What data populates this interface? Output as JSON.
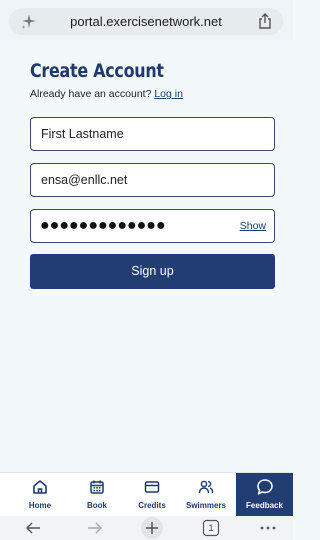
{
  "browser": {
    "url": "portal.exercisenetwork.net",
    "tab_count": "1"
  },
  "form": {
    "title": "Create Account",
    "subtitle_text": "Already have an account?",
    "login_link": "Log in",
    "name_value": "First Lastname",
    "email_value": "ensa@enllc.net",
    "password_masked": "●●●●●●●●●●●●●",
    "show_label": "Show",
    "signup_label": "Sign up"
  },
  "nav": {
    "items": [
      {
        "label": "Home",
        "icon": "home-icon"
      },
      {
        "label": "Book",
        "icon": "calendar-icon"
      },
      {
        "label": "Credits",
        "icon": "card-icon"
      },
      {
        "label": "Swimmers",
        "icon": "people-icon"
      },
      {
        "label": "Feedback",
        "icon": "chat-icon"
      }
    ],
    "active": "Feedback"
  },
  "colors": {
    "brand": "#1e3a6e",
    "button": "#213d72",
    "background": "#f3f8fb"
  }
}
